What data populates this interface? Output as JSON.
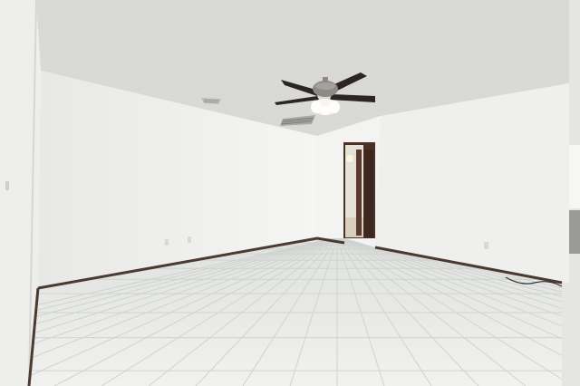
{
  "photo": {
    "subject": "",
    "elements": [
      "textured-ceiling",
      "ceiling-fan-with-light",
      "air-vent",
      "return-vent",
      "open-doorway",
      "tile-floor",
      "baseboard",
      "wall-outlet"
    ]
  },
  "colors": {
    "wall_left": "#f2f2f0",
    "wall_back": "#f4f4f2",
    "wall_right": "#eeeeec",
    "ceiling": "#dcdcd8",
    "floor": "#e7e9e6",
    "grout": "#cfd3d0",
    "baseboard": "#4b3a30",
    "door_wood": "#4a3026",
    "fan_blade": "#2b2624",
    "fan_metal": "#8c8a87",
    "light_glass": "#f7f5ee"
  }
}
